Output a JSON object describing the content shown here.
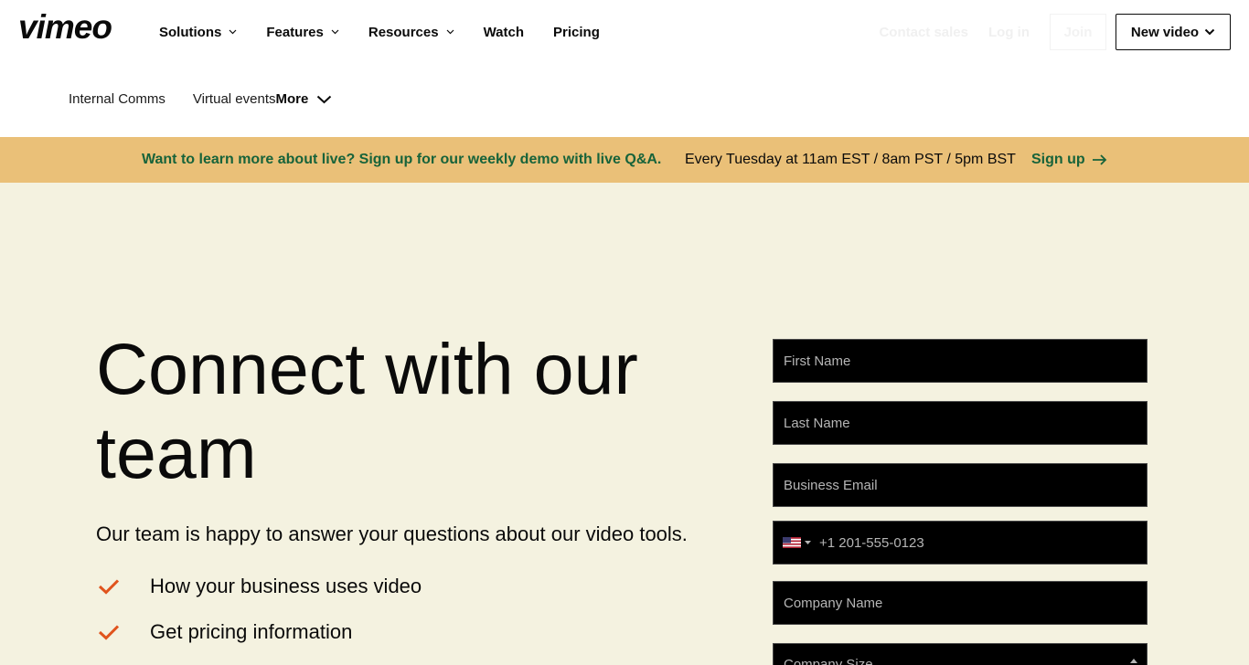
{
  "brand": {
    "name": "vimeo"
  },
  "nav": {
    "items": [
      {
        "label": "Solutions",
        "dropdown": true
      },
      {
        "label": "Features",
        "dropdown": true
      },
      {
        "label": "Resources",
        "dropdown": true
      },
      {
        "label": "Watch",
        "dropdown": false
      },
      {
        "label": "Pricing",
        "dropdown": false
      }
    ],
    "contact_sales": "Contact sales",
    "login": "Log in",
    "join": "Join",
    "new_video": "New video"
  },
  "subnav": {
    "items": [
      "Internal Comms",
      "Virtual events"
    ],
    "more": "More"
  },
  "banner": {
    "promo": "Want to learn more about live? Sign up for our weekly demo with live Q&A.",
    "schedule": "Every Tuesday at 11am EST / 8am PST / 5pm BST",
    "cta": "Sign up"
  },
  "hero": {
    "title": "Connect with our team",
    "subtitle": "Our team is happy to answer your questions about our video tools.",
    "checklist": [
      "How your business uses video",
      "Get pricing information"
    ]
  },
  "form": {
    "first_name_placeholder": "First Name",
    "last_name_placeholder": "Last Name",
    "email_placeholder": "Business Email",
    "phone_placeholder": "+1 201-555-0123",
    "company_placeholder": "Company Name",
    "company_size_placeholder": "Company Size"
  },
  "colors": {
    "page_bg": "#f4f2e0",
    "banner_bg": "#eac078",
    "banner_accent": "#17633a",
    "check": "#e0541d",
    "field_bg": "#000000"
  }
}
